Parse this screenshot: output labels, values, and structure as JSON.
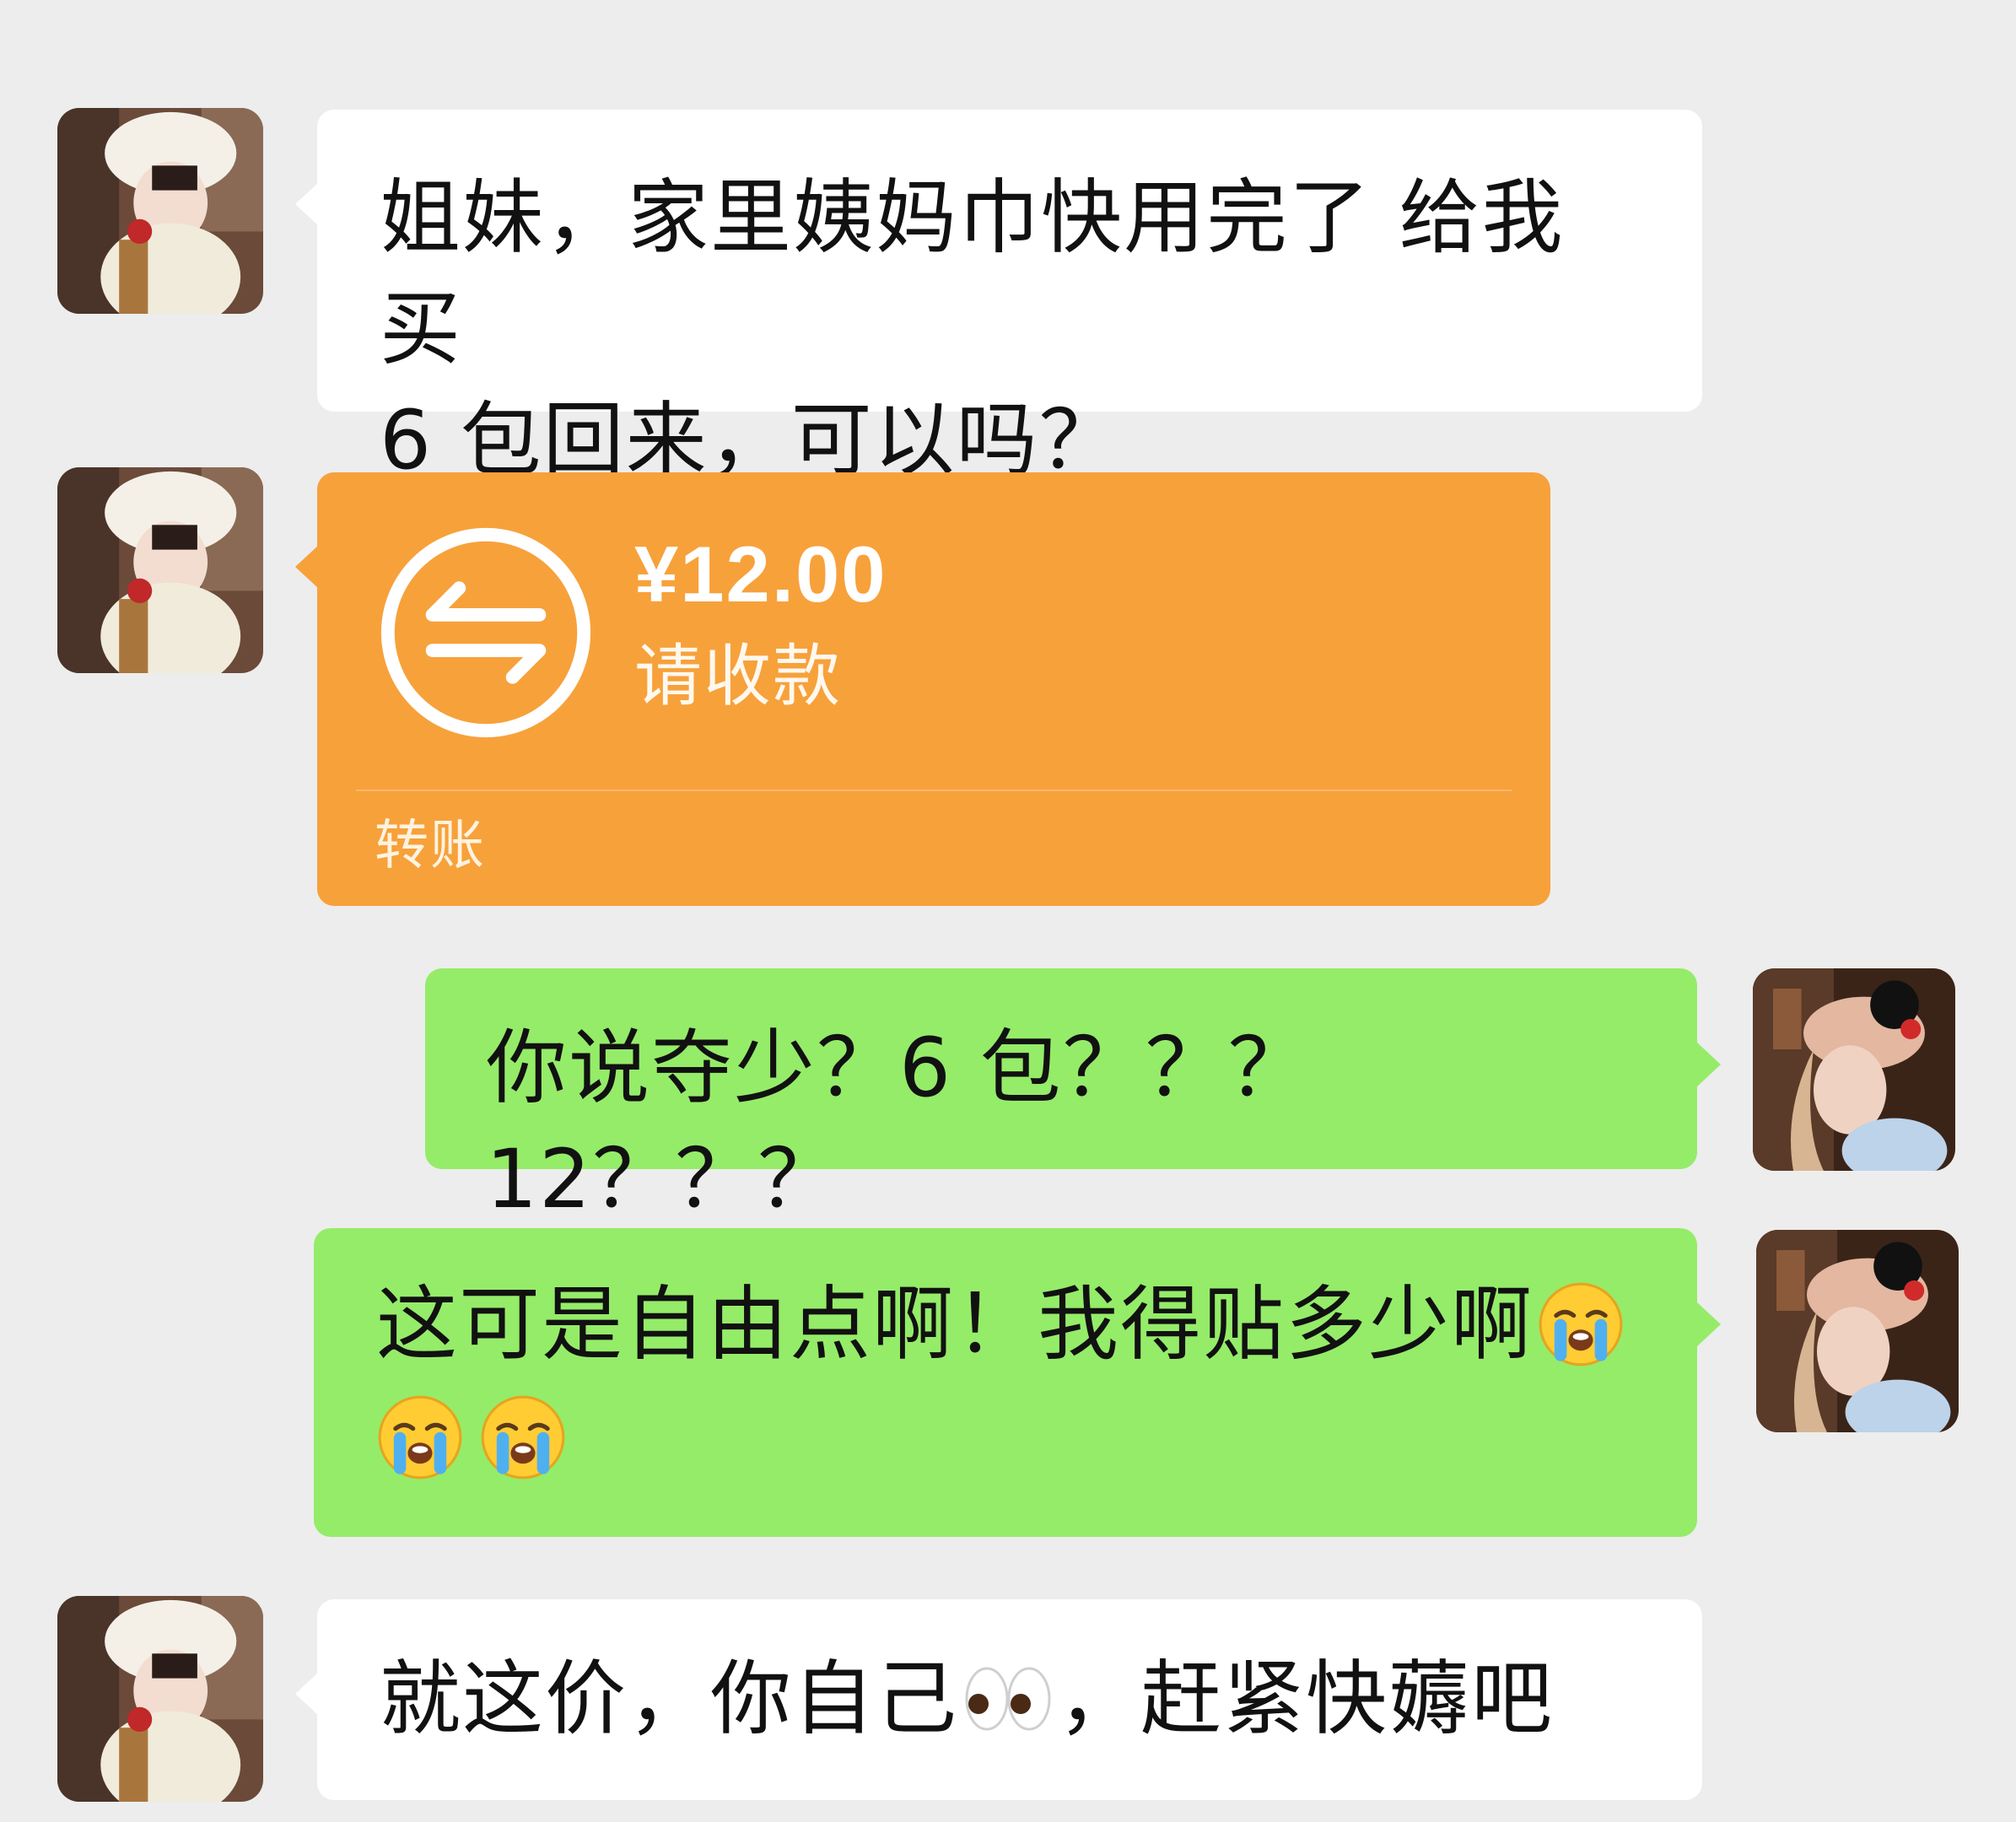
{
  "chat": {
    "messages": [
      {
        "sender": "friend",
        "type": "text",
        "text": "姐妹，家里姨妈巾快用完了 给我买\n6 包回来，可以吗？"
      },
      {
        "sender": "friend",
        "type": "transfer",
        "icon": "transfer-arrows-icon",
        "amount": "¥12.00",
        "status": "请收款",
        "footer": "转账"
      },
      {
        "sender": "me",
        "type": "text",
        "text": "你说夺少？6 包？？？12？？？"
      },
      {
        "sender": "me",
        "type": "text",
        "text_line1": "这可是自由点啊！我得贴多少啊",
        "emojis": [
          "loudly-crying-face-emoji",
          "loudly-crying-face-emoji",
          "loudly-crying-face-emoji"
        ]
      },
      {
        "sender": "friend",
        "type": "text",
        "text_part1": "就这价，你自己",
        "emoji": "eyes-emoji",
        "text_part2": "，赶紧快薅吧"
      }
    ]
  },
  "colors": {
    "background": "#ededed",
    "incoming_bubble": "#ffffff",
    "outgoing_bubble": "#95ec69",
    "transfer_bubble": "#f7a13b"
  }
}
